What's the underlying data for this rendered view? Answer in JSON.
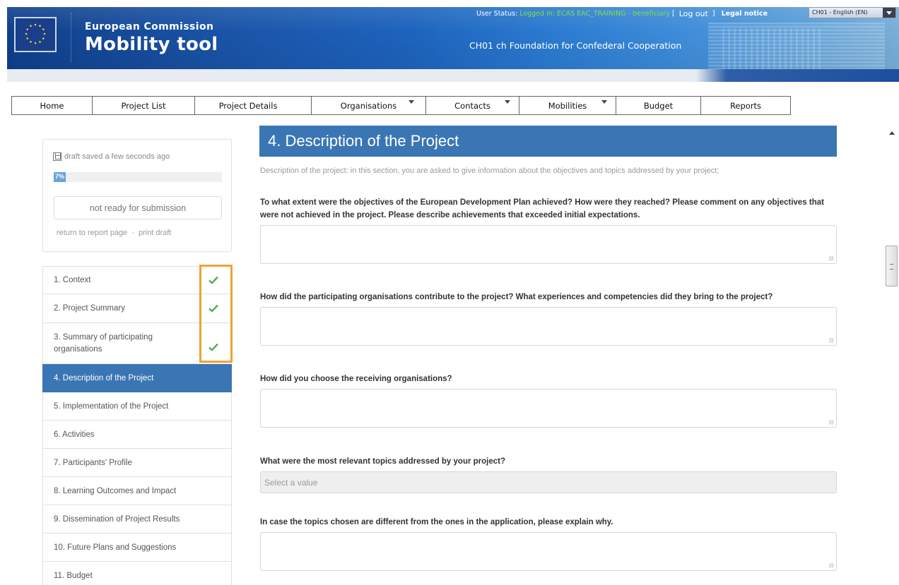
{
  "header": {
    "brand_top": "European Commission",
    "brand_main": "Mobility tool",
    "organisation": "CH01 ch Foundation for Confederal Cooperation",
    "user_status_label": "User Status:",
    "user_status_value": "Logged in: ECAS EAC_TRAINING - beneficiary",
    "bracket_open": "[",
    "logout": "Log out",
    "bracket_close": "]",
    "legal_notice": "Legal notice",
    "language": "CH01 - English (EN)"
  },
  "nav": {
    "items": [
      {
        "label": "Home",
        "dropdown": false
      },
      {
        "label": "Project List",
        "dropdown": false
      },
      {
        "label": "Project Details",
        "dropdown": false
      },
      {
        "label": "Organisations",
        "dropdown": true
      },
      {
        "label": "Contacts",
        "dropdown": true
      },
      {
        "label": "Mobilities",
        "dropdown": true
      },
      {
        "label": "Budget",
        "dropdown": false
      },
      {
        "label": "Reports",
        "dropdown": false
      }
    ]
  },
  "sidebar": {
    "draft_status": "draft saved a few seconds ago",
    "progress_label": "7%",
    "progress_percent": 7,
    "submit_status": "not ready for submission",
    "link_return": "return to report page",
    "link_separator": "·",
    "link_print": "print draft",
    "sections": [
      {
        "label": "1. Context",
        "complete": true
      },
      {
        "label": "2. Project Summary",
        "complete": true
      },
      {
        "label": "3. Summary of participating organisations",
        "complete": true
      },
      {
        "label": "4. Description of the Project",
        "active": true
      },
      {
        "label": "5. Implementation of the Project"
      },
      {
        "label": "6. Activities"
      },
      {
        "label": "7. Participants' Profile"
      },
      {
        "label": "8. Learning Outcomes and Impact"
      },
      {
        "label": "9. Dissemination of Project Results"
      },
      {
        "label": "10. Future Plans and Suggestions"
      },
      {
        "label": "11. Budget"
      }
    ]
  },
  "main": {
    "title": "4. Description of the Project",
    "subtitle": "Description of the project: in this section, you are asked to give information about the objectives and topics addressed by your project;",
    "questions": [
      "To what extent were the objectives of the European Development Plan achieved? How were they reached? Please comment on any objectives that were not achieved in the project. Please describe achievements that exceeded initial expectations.",
      "How did the participating organisations contribute to the project? What experiences and competencies did they bring to the project?",
      "How did you choose the receiving organisations?",
      "What were the most relevant topics addressed by your project?",
      "In case the topics chosen are different from the ones in the application, please explain why."
    ],
    "select_placeholder": "Select a value"
  },
  "colors": {
    "accent_blue": "#3b76b4",
    "check_green": "#4caf50",
    "highlight_orange": "#f0a330",
    "status_green": "#7ee04a"
  }
}
